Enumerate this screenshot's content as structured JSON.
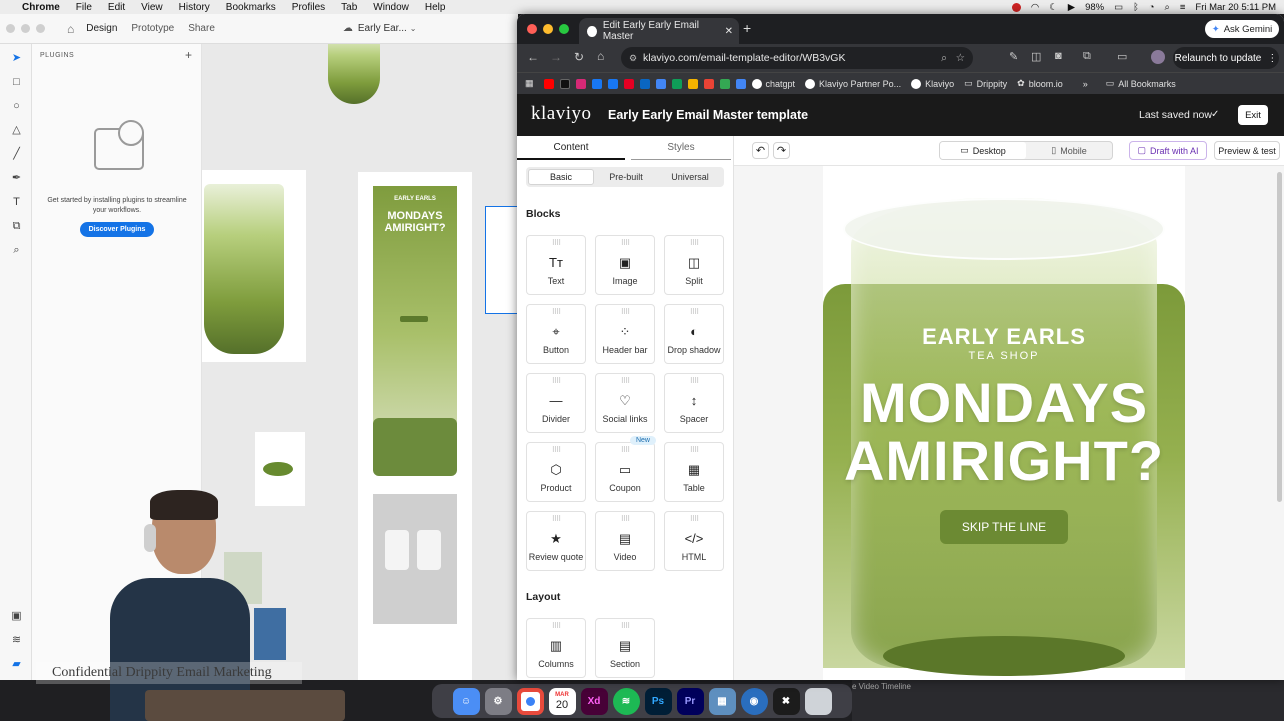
{
  "menubar": {
    "app": "Chrome",
    "items": [
      "File",
      "Edit",
      "View",
      "History",
      "Bookmarks",
      "Profiles",
      "Tab",
      "Window",
      "Help"
    ],
    "battery": "98%",
    "datetime": "Fri Mar 20  5:11 PM"
  },
  "xd": {
    "tabs": [
      "Design",
      "Prototype",
      "Share"
    ],
    "doc_title": "Early Ear...",
    "plugins_title": "PLUGINS",
    "plugins_add": "+",
    "plugins_text": "Get started by installing plugins to streamline your workflows.",
    "discover_button": "Discover Plugins",
    "canvas_mini_title_1": "MONDAYS",
    "canvas_mini_title_2": "AMIRIGHT?",
    "canvas_mini_brand": "EARLY EARLS"
  },
  "overlay": {
    "watermark": "Confidential Drippity Email Marketing"
  },
  "chrome": {
    "tab_title": "Edit Early Early Email Master",
    "new_tab": "+",
    "url": "klaviyo.com/email-template-editor/WB3vGK",
    "ask_gemini": "Ask Gemini",
    "relaunch": "Relaunch to update",
    "bookmarks": [
      "chatgpt",
      "Klaviyo Partner Po...",
      "Klaviyo",
      "Drippity",
      "bloom.io"
    ],
    "more_bookmarks": "»",
    "all_bookmarks": "All Bookmarks"
  },
  "klaviyo": {
    "logo": "klaviyo",
    "template_title": "Early Early Email Master template",
    "saved_status": "Last saved now",
    "exit_button": "Exit",
    "tabs": [
      "Content",
      "Styles"
    ],
    "segments": [
      "Basic",
      "Pre-built",
      "Universal"
    ],
    "blocks_heading": "Blocks",
    "blocks": [
      {
        "label": "Text",
        "icon": "Tт"
      },
      {
        "label": "Image",
        "icon": "▣"
      },
      {
        "label": "Split",
        "icon": "◫"
      },
      {
        "label": "Button",
        "icon": "⌖"
      },
      {
        "label": "Header bar",
        "icon": "⁘"
      },
      {
        "label": "Drop shadow",
        "icon": "◐"
      },
      {
        "label": "Divider",
        "icon": "—"
      },
      {
        "label": "Social links",
        "icon": "♡"
      },
      {
        "label": "Spacer",
        "icon": "↕"
      },
      {
        "label": "Product",
        "icon": "⬡"
      },
      {
        "label": "Coupon",
        "icon": "▭"
      },
      {
        "label": "Table",
        "icon": "▦"
      },
      {
        "label": "Review quote",
        "icon": "★"
      },
      {
        "label": "Video",
        "icon": "▤"
      },
      {
        "label": "HTML",
        "icon": "</>"
      }
    ],
    "new_badge": "New",
    "layout_heading": "Layout",
    "layout_blocks": [
      {
        "label": "Columns",
        "icon": "▥"
      },
      {
        "label": "Section",
        "icon": "▤"
      }
    ],
    "device_desktop": "Desktop",
    "device_mobile": "Mobile",
    "draft_ai": "Draft with AI",
    "preview_test": "Preview & test",
    "email": {
      "brand": "EARLY EARLS",
      "sub_brand": "TEA SHOP",
      "headline_1": "MONDAYS",
      "headline_2": "AMIRIGHT?",
      "cta": "SKIP THE LINE"
    }
  },
  "dock": [
    "Finder",
    "System Settings",
    "Chrome",
    "Calendar",
    "Xd",
    "Spotify",
    "Photoshop",
    "Premiere",
    "Preview",
    "Proxyman",
    "Xcode",
    "Trash"
  ],
  "dock_calendar_month": "MAR",
  "dock_calendar_day": "20",
  "bottom_bar_text": "e Video Timeline"
}
